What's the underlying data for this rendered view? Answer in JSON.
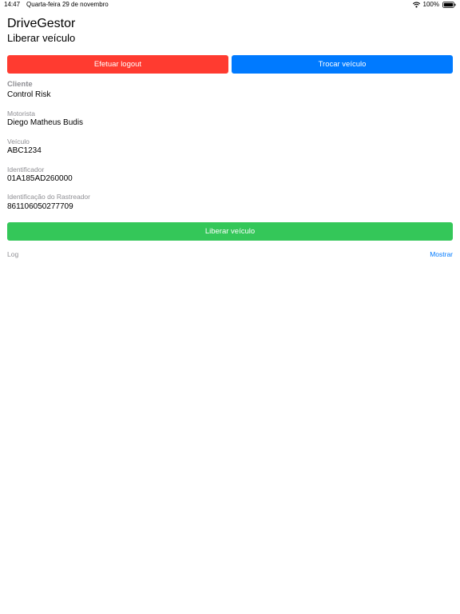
{
  "status_bar": {
    "time": "14:47",
    "date": "Quarta-feira 29 de novembro",
    "battery": "100%"
  },
  "header": {
    "app_title": "DriveGestor",
    "screen_title": "Liberar veículo"
  },
  "actions": {
    "logout_label": "Efetuar logout",
    "switch_vehicle_label": "Trocar veículo"
  },
  "fields": {
    "client": {
      "label": "Cliente",
      "value": "Control Risk"
    },
    "driver": {
      "label": "Motorista",
      "value": "Diego Matheus Budis"
    },
    "vehicle": {
      "label": "Veículo",
      "value": "ABC1234"
    },
    "identifier": {
      "label": "Identificador",
      "value": "01A185AD260000"
    },
    "tracker": {
      "label": "Identificação do Rastreador",
      "value": "861106050277709"
    }
  },
  "release_label": "Liberar veículo",
  "log": {
    "label": "Log",
    "show_label": "Mostrar"
  },
  "colors": {
    "logout": "#ff3b30",
    "switch": "#007aff",
    "release": "#34c759",
    "link": "#007aff",
    "secondary_text": "#8e8e93"
  }
}
